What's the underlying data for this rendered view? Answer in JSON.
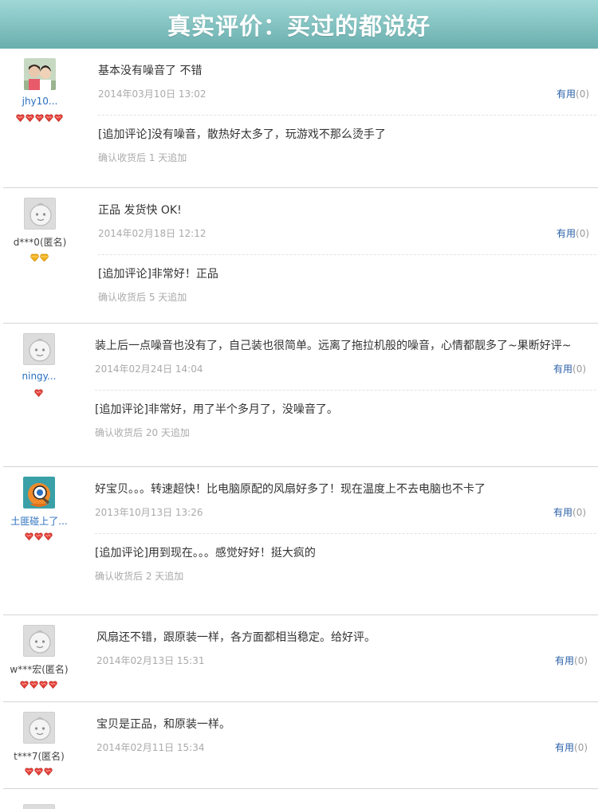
{
  "banner": {
    "title": "真实评价：买过的都说好"
  },
  "labels": {
    "useful": "有用"
  },
  "colors": {
    "banner_top": "#9fd8d6",
    "banner_bottom": "#6aaeae",
    "link": "#2a6fbf",
    "gem_red": "#e8433b",
    "gem_gold": "#f2b21c"
  },
  "reviews": [
    {
      "user": "jhy10...",
      "anonymous": false,
      "avatar": "photo-avatar",
      "rank_icons": 5,
      "rank_type": "heart",
      "text": "基本没有噪音了 不错",
      "date": "2014年03月10日 13:02",
      "useful_count": "(0)",
      "append_text": "[追加评论]没有噪音，散热好太多了，玩游戏不那么烫手了",
      "append_note": "确认收货后 1 天追加"
    },
    {
      "user": "d***0(匿名)",
      "anonymous": true,
      "avatar": "default-avatar",
      "rank_icons": 2,
      "rank_type": "diamond",
      "text": "正品 发货快 OK!",
      "date": "2014年02月18日 12:12",
      "useful_count": "(0)",
      "append_text": "[追加评论]非常好！正品",
      "append_note": "确认收货后 5 天追加"
    },
    {
      "user": "ningy...",
      "anonymous": false,
      "avatar": "default-avatar",
      "rank_icons": 1,
      "rank_type": "heart",
      "text": "装上后一点噪音也没有了，自己装也很简单。远离了拖拉机般的噪音，心情都靓多了~果断好评~",
      "date": "2014年02月24日 14:04",
      "useful_count": "(0)",
      "append_text": "[追加评论]非常好，用了半个多月了，没噪音了。",
      "append_note": "确认收货后 20 天追加"
    },
    {
      "user": "土匪碰上了...",
      "anonymous": false,
      "avatar": "cartoon-avatar",
      "rank_icons": 3,
      "rank_type": "heart",
      "text": "好宝贝。。。转速超快！比电脑原配的风扇好多了！现在温度上不去电脑也不卡了",
      "date": "2013年10月13日 13:26",
      "useful_count": "(0)",
      "append_text": "[追加评论]用到现在。。。感觉好好！挺大疯的",
      "append_note": "确认收货后 2 天追加"
    },
    {
      "user": "w***宏(匿名)",
      "anonymous": true,
      "avatar": "default-avatar",
      "rank_icons": 4,
      "rank_type": "heart",
      "text": "风扇还不错，跟原装一样，各方面都相当稳定。给好评。",
      "date": "2014年02月13日 15:31",
      "useful_count": "(0)"
    },
    {
      "user": "t***7(匿名)",
      "anonymous": true,
      "avatar": "default-avatar",
      "rank_icons": 3,
      "rank_type": "heart",
      "text": "宝贝是正品，和原装一样。",
      "date": "2014年02月11日 15:34",
      "useful_count": "(0)"
    }
  ]
}
